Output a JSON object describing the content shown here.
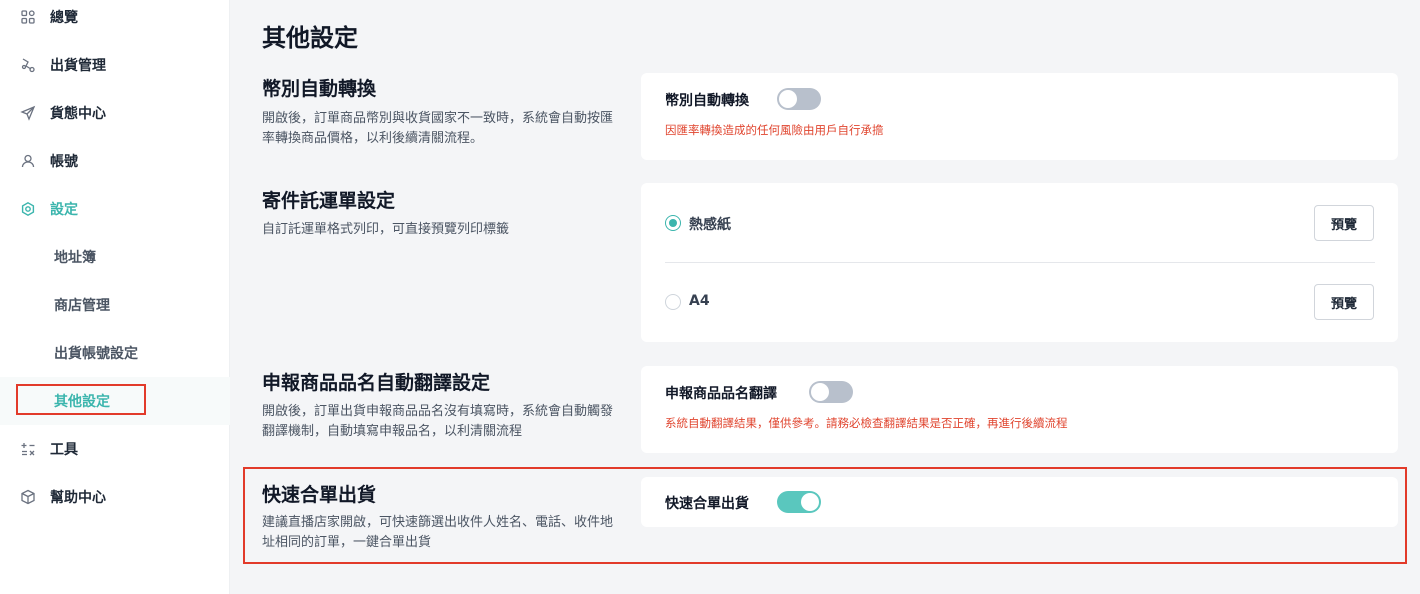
{
  "sidebar": {
    "items": [
      {
        "label": "總覽",
        "icon": "dashboard-icon"
      },
      {
        "label": "出貨管理",
        "icon": "shipping-icon"
      },
      {
        "label": "貨態中心",
        "icon": "send-icon"
      },
      {
        "label": "帳號",
        "icon": "user-icon"
      },
      {
        "label": "設定",
        "icon": "settings-icon"
      },
      {
        "label": "工具",
        "icon": "tools-icon"
      },
      {
        "label": "幫助中心",
        "icon": "help-box-icon"
      }
    ],
    "sub_items": [
      {
        "label": "地址簿"
      },
      {
        "label": "商店管理"
      },
      {
        "label": "出貨帳號設定"
      },
      {
        "label": "其他設定"
      }
    ]
  },
  "page": {
    "title": "其他設定"
  },
  "sections": {
    "currency": {
      "title": "幣別自動轉換",
      "description": "開啟後，訂單商品幣別與收貨國家不一致時，系統會自動按匯率轉換商品價格，以利後續清關流程。",
      "toggle_label": "幣別自動轉換",
      "toggle_on": false,
      "warning": "因匯率轉換造成的任何風險由用戶自行承擔"
    },
    "waybill": {
      "title": "寄件託運單設定",
      "description": "自訂託運單格式列印，可直接預覽列印標籤",
      "options": [
        {
          "label": "熱感紙",
          "selected": true,
          "button": "預覽"
        },
        {
          "label": "A4",
          "selected": false,
          "button": "預覽"
        }
      ]
    },
    "translation": {
      "title": "申報商品品名自動翻譯設定",
      "description": "開啟後，訂單出貨申報商品品名沒有填寫時，系統會自動觸發翻譯機制，自動填寫申報品名，以利清關流程",
      "toggle_label": "申報商品品名翻譯",
      "toggle_on": false,
      "warning": "系統自動翻譯結果，僅供參考。請務必檢查翻譯結果是否正確，再進行後續流程"
    },
    "merge": {
      "title": "快速合單出貨",
      "description": "建議直播店家開啟，可快速篩選出收件人姓名、電話、收件地址相同的訂單，一鍵合單出貨",
      "toggle_label": "快速合單出貨",
      "toggle_on": true
    }
  },
  "colors": {
    "accent": "#3bb5ad",
    "warning": "#e0452f",
    "highlight": "#e23a2a"
  }
}
